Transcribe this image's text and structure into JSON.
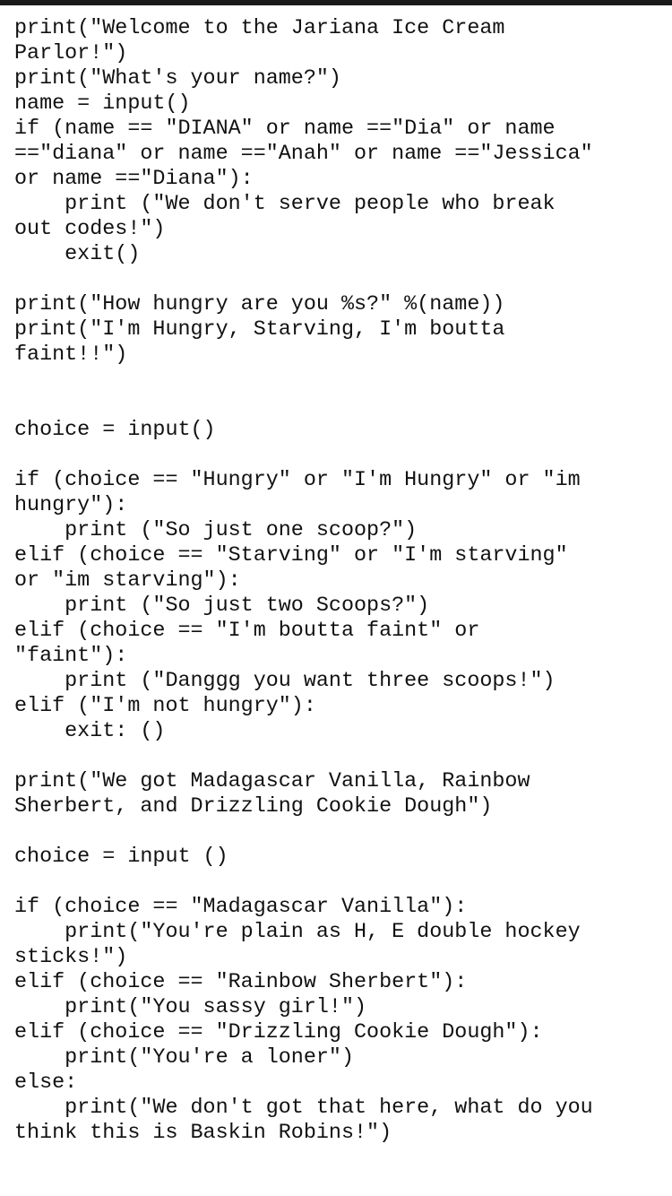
{
  "code": {
    "lines": [
      "print(\"Welcome to the Jariana Ice Cream",
      "Parlor!\")",
      "print(\"What's your name?\")",
      "name = input()",
      "if (name == \"DIANA\" or name ==\"Dia\" or name",
      "==\"diana\" or name ==\"Anah\" or name ==\"Jessica\"",
      "or name ==\"Diana\"):",
      "    print (\"We don't serve people who break",
      "out codes!\")",
      "    exit()",
      "",
      "print(\"How hungry are you %s?\" %(name))",
      "print(\"I'm Hungry, Starving, I'm boutta",
      "faint!!\")",
      "",
      "",
      "choice = input()",
      "",
      "if (choice == \"Hungry\" or \"I'm Hungry\" or \"im",
      "hungry\"):",
      "    print (\"So just one scoop?\")",
      "elif (choice == \"Starving\" or \"I'm starving\"",
      "or \"im starving\"):",
      "    print (\"So just two Scoops?\")",
      "elif (choice == \"I'm boutta faint\" or",
      "\"faint\"):",
      "    print (\"Danggg you want three scoops!\")",
      "elif (\"I'm not hungry\"):",
      "    exit: ()",
      "",
      "print(\"We got Madagascar Vanilla, Rainbow",
      "Sherbert, and Drizzling Cookie Dough\")",
      "",
      "choice = input ()",
      "",
      "if (choice == \"Madagascar Vanilla\"):",
      "    print(\"You're plain as H, E double hockey",
      "sticks!\")",
      "elif (choice == \"Rainbow Sherbert\"):",
      "    print(\"You sassy girl!\")",
      "elif (choice == \"Drizzling Cookie Dough\"):",
      "    print(\"You're a loner\")",
      "else:",
      "    print(\"We don't got that here, what do you",
      "think this is Baskin Robins!\")"
    ]
  }
}
